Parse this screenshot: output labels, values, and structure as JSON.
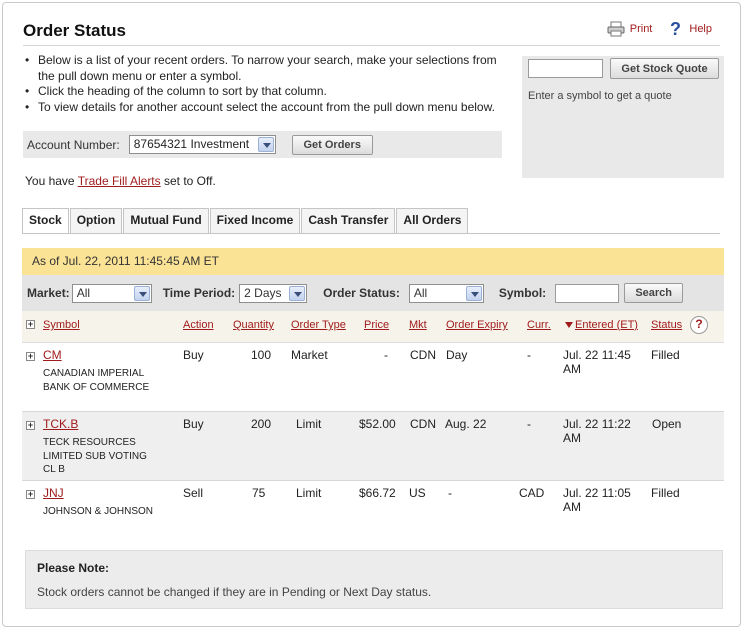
{
  "page": {
    "title": "Order Status",
    "print_label": "Print",
    "help_label": "Help"
  },
  "instructions": [
    "Below is a list of your recent orders. To narrow your search, make your selections from the pull down menu or enter a symbol.",
    "Click the heading of the column to sort by that column.",
    "To view details for another account select the account from the pull down menu below."
  ],
  "quote": {
    "input_value": "",
    "button_label": "Get Stock Quote",
    "hint": "Enter a symbol to get a quote"
  },
  "account": {
    "label": "Account Number:",
    "selected": "87654321 Investment",
    "button_label": "Get Orders"
  },
  "alert": {
    "prefix": "You have ",
    "link": "Trade Fill Alerts",
    "suffix": " set to Off."
  },
  "tabs": [
    "Stock",
    "Option",
    "Mutual Fund",
    "Fixed Income",
    "Cash Transfer",
    "All Orders"
  ],
  "as_of": "As of Jul. 22, 2011 11:45:45 AM ET",
  "filters": {
    "market_label": "Market:",
    "market_value": "All",
    "period_label": "Time Period:",
    "period_value": "2 Days",
    "status_label": "Order Status:",
    "status_value": "All",
    "symbol_label": "Symbol:",
    "symbol_value": "",
    "search_label": "Search"
  },
  "table": {
    "headers": {
      "expand": "+",
      "symbol": "Symbol",
      "action": "Action",
      "quantity": "Quantity",
      "order_type": "Order Type",
      "price": "Price",
      "mkt": "Mkt",
      "order_expiry": "Order Expiry",
      "curr": "Curr.",
      "entered": "Entered (ET)",
      "status": "Status",
      "help": "?"
    },
    "rows": [
      {
        "symbol": "CM",
        "name": "CANADIAN IMPERIAL BANK OF COMMERCE",
        "action": "Buy",
        "quantity": "100",
        "order_type": "Market",
        "price": "-",
        "mkt": "CDN",
        "expiry": "Day",
        "curr": "-",
        "entered_1": "Jul. 22 11:45",
        "entered_2": "AM",
        "status": "Filled"
      },
      {
        "symbol": "TCK.B",
        "name": "TECK RESOURCES LIMITED SUB VOTING CL B",
        "action": "Buy",
        "quantity": "200",
        "order_type": "Limit",
        "price": "$52.00",
        "mkt": "CDN",
        "expiry": "Aug. 22",
        "curr": "-",
        "entered_1": "Jul. 22 11:22",
        "entered_2": "AM",
        "status": "Open"
      },
      {
        "symbol": "JNJ",
        "name": "JOHNSON & JOHNSON",
        "action": "Sell",
        "quantity": "75",
        "order_type": "Limit",
        "price": "$66.72",
        "mkt": "US",
        "expiry": "-",
        "curr": "CAD",
        "entered_1": "Jul. 22 11:05",
        "entered_2": "AM",
        "status": "Filled"
      }
    ]
  },
  "note": {
    "title": "Please Note:",
    "text": "Stock orders cannot be changed if they are in Pending or Next Day status."
  },
  "colors": {
    "link": "#a01c1c",
    "as_of_bar": "#fbe396",
    "filter_bar": "#e4e4e4"
  }
}
